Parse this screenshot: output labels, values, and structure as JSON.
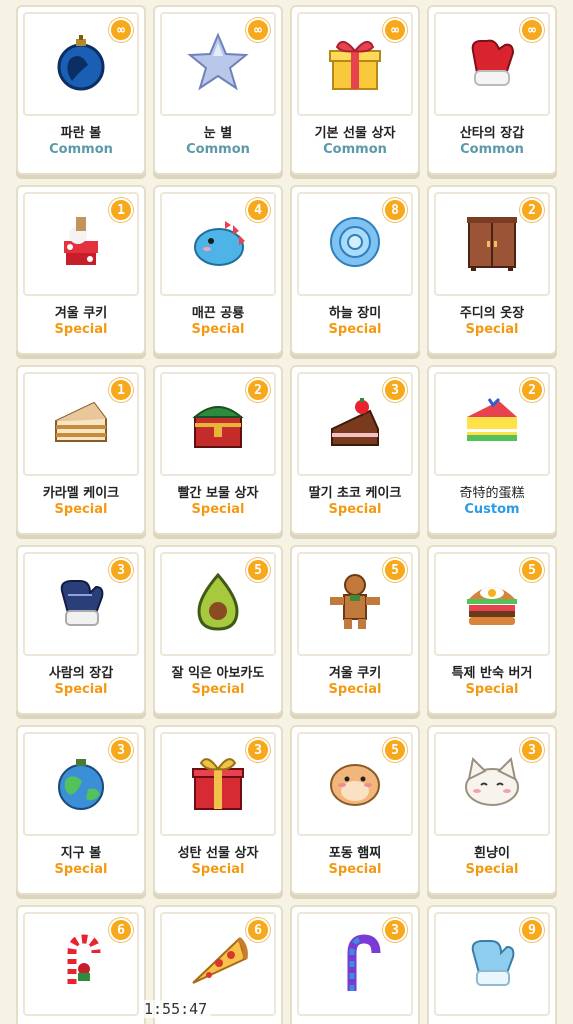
{
  "items": [
    {
      "name": "파란 볼",
      "rarity": "Common",
      "rtype": "common",
      "count": "∞",
      "icon": "blue-ornament-icon"
    },
    {
      "name": "눈 별",
      "rarity": "Common",
      "rtype": "common",
      "count": "∞",
      "icon": "snow-star-icon"
    },
    {
      "name": "기본 선물 상자",
      "rarity": "Common",
      "rtype": "common",
      "count": "∞",
      "icon": "yellow-gift-box-icon"
    },
    {
      "name": "산타의 장갑",
      "rarity": "Common",
      "rtype": "common",
      "count": "∞",
      "icon": "santa-mitten-icon"
    },
    {
      "name": "겨울 쿠키",
      "rarity": "Special",
      "rtype": "special",
      "count": "1",
      "icon": "winter-cookie-icon"
    },
    {
      "name": "매끈 공룡",
      "rarity": "Special",
      "rtype": "special",
      "count": "4",
      "icon": "blue-dinosaur-icon"
    },
    {
      "name": "하늘 장미",
      "rarity": "Special",
      "rtype": "special",
      "count": "8",
      "icon": "blue-rose-icon"
    },
    {
      "name": "주디의 옷장",
      "rarity": "Special",
      "rtype": "special",
      "count": "2",
      "icon": "wardrobe-icon"
    },
    {
      "name": "카라멜 케이크",
      "rarity": "Special",
      "rtype": "special",
      "count": "1",
      "icon": "caramel-cake-icon"
    },
    {
      "name": "빨간 보물 상자",
      "rarity": "Special",
      "rtype": "special",
      "count": "2",
      "icon": "red-treasure-chest-icon"
    },
    {
      "name": "딸기 초코 케이크",
      "rarity": "Special",
      "rtype": "special",
      "count": "3",
      "icon": "strawberry-choco-cake-icon"
    },
    {
      "name": "奇特的蛋糕",
      "rarity": "Custom",
      "rtype": "custom",
      "count": "2",
      "icon": "rainbow-cake-icon"
    },
    {
      "name": "사람의 장갑",
      "rarity": "Special",
      "rtype": "special",
      "count": "3",
      "icon": "navy-mitten-icon"
    },
    {
      "name": "잘 익은 아보카도",
      "rarity": "Special",
      "rtype": "special",
      "count": "5",
      "icon": "avocado-icon"
    },
    {
      "name": "겨울 쿠키",
      "rarity": "Special",
      "rtype": "special",
      "count": "5",
      "icon": "gingerbread-man-icon"
    },
    {
      "name": "특제 반숙 버거",
      "rarity": "Special",
      "rtype": "special",
      "count": "5",
      "icon": "burger-icon"
    },
    {
      "name": "지구 볼",
      "rarity": "Special",
      "rtype": "special",
      "count": "3",
      "icon": "earth-ornament-icon"
    },
    {
      "name": "성탄 선물 상자",
      "rarity": "Special",
      "rtype": "special",
      "count": "3",
      "icon": "red-gift-box-icon"
    },
    {
      "name": "포동 햄찌",
      "rarity": "Special",
      "rtype": "special",
      "count": "5",
      "icon": "hamster-icon"
    },
    {
      "name": "흰냥이",
      "rarity": "Special",
      "rtype": "special",
      "count": "3",
      "icon": "white-cat-icon"
    },
    {
      "name": "",
      "rarity": "",
      "rtype": "special",
      "count": "6",
      "icon": "candy-cane-icon"
    },
    {
      "name": "",
      "rarity": "",
      "rtype": "special",
      "count": "6",
      "icon": "pizza-slice-icon"
    },
    {
      "name": "",
      "rarity": "",
      "rtype": "special",
      "count": "3",
      "icon": "rainbow-candy-cane-icon"
    },
    {
      "name": "",
      "rarity": "",
      "rtype": "special",
      "count": "9",
      "icon": "light-blue-mitten-icon"
    }
  ],
  "overlay": {
    "timer": "1:55:47"
  },
  "colors": {
    "background": "#f6f2e4",
    "badge": "#f7a81b",
    "common": "#5b9aa8",
    "special": "#f39a12",
    "custom": "#2b9be6"
  }
}
